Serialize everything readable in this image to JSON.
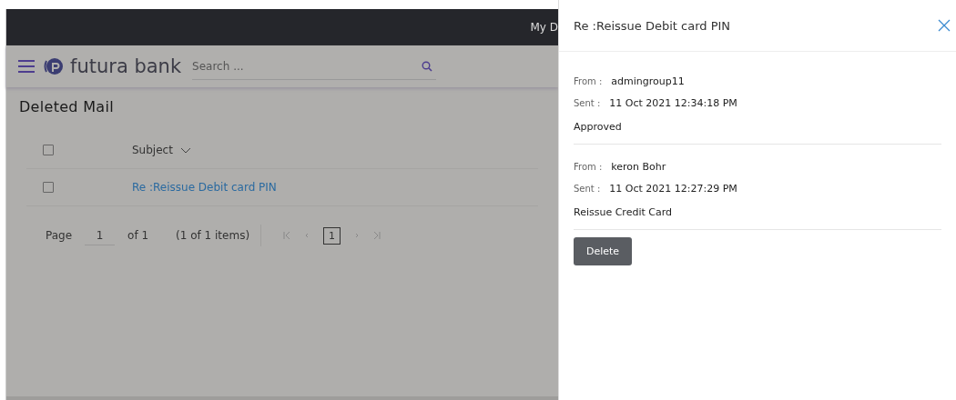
{
  "top_bar": {
    "link": "My D"
  },
  "header": {
    "brand": "futura bank",
    "search": {
      "placeholder": "Search ..."
    }
  },
  "page": {
    "title": "Deleted Mail"
  },
  "table": {
    "select_all": {
      "checked": false
    },
    "columns": [
      {
        "label": "Subject"
      }
    ],
    "rows": [
      {
        "subject": "Re :Reissue Debit card PIN",
        "checked": false
      }
    ]
  },
  "pager": {
    "label": "Page",
    "page": "1",
    "of": "of 1",
    "items": "(1 of 1 items)",
    "current": "1"
  },
  "panel": {
    "title": "Re :Reissue Debit card PIN",
    "messages": [
      {
        "from_label": "From :",
        "from": "admingroup11",
        "sent_label": "Sent :",
        "sent": "11 Oct 2021 12:34:18 PM",
        "body": "Approved"
      },
      {
        "from_label": "From :",
        "from": "keron Bohr",
        "sent_label": "Sent :",
        "sent": "11 Oct 2021 12:27:29 PM",
        "body": "Reissue Credit Card"
      }
    ],
    "delete_button": "Delete"
  }
}
